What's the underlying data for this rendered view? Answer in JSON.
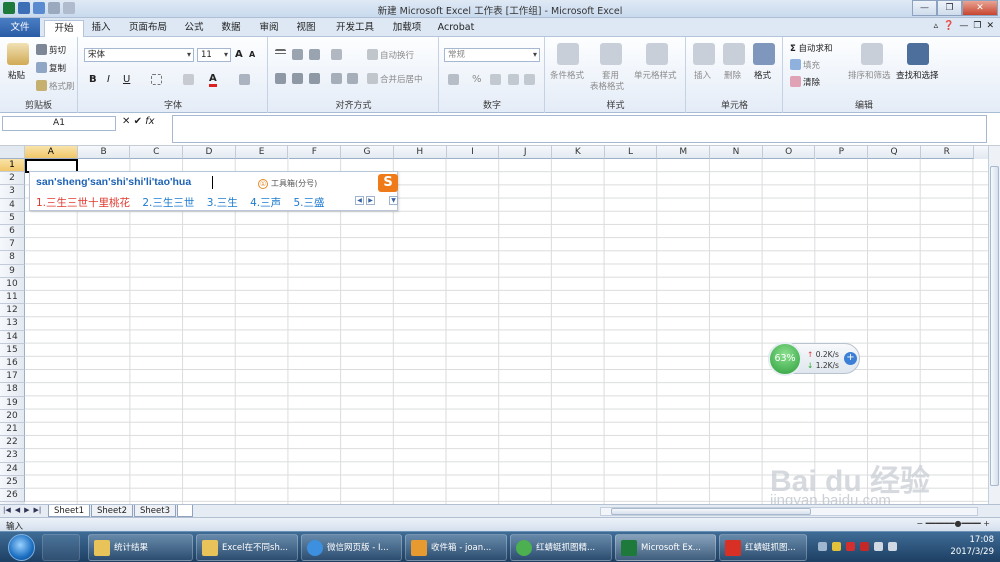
{
  "window": {
    "title": "新建 Microsoft Excel 工作表 [工作组] - Microsoft Excel"
  },
  "tabs": [
    "文件",
    "开始",
    "插入",
    "页面布局",
    "公式",
    "数据",
    "审阅",
    "视图",
    "开发工具",
    "加载项",
    "Acrobat"
  ],
  "active_tab": "开始",
  "ribbon": {
    "clipboard": {
      "label": "剪贴板",
      "paste": "粘贴",
      "cut": "剪切",
      "copy": "复制",
      "format_painter": "格式刷"
    },
    "font": {
      "label": "字体",
      "font_name": "宋体",
      "font_size": "11",
      "bold": "B",
      "italic": "I",
      "underline": "U",
      "grow": "A",
      "shrink": "A",
      "font_color": "A",
      "phonetic": "wén"
    },
    "alignment": {
      "label": "对齐方式",
      "wrap": "自动换行",
      "merge": "合并后居中"
    },
    "number": {
      "label": "数字",
      "format": "常规",
      "percent": "%"
    },
    "styles": {
      "label": "样式",
      "conditional": "条件格式",
      "table_format_1": "套用",
      "table_format_2": "表格格式",
      "cell_styles": "单元格样式"
    },
    "cells": {
      "label": "单元格",
      "insert": "插入",
      "delete": "删除",
      "format": "格式"
    },
    "editing": {
      "label": "编辑",
      "autosum": "自动求和",
      "fill": "填充",
      "clear": "清除",
      "sort": "排序和筛选",
      "find": "查找和选择"
    }
  },
  "formula_bar": {
    "name_box": "A1",
    "fx": "fx",
    "content": ""
  },
  "columns": [
    "A",
    "B",
    "C",
    "D",
    "E",
    "F",
    "G",
    "H",
    "I",
    "J",
    "K",
    "L",
    "M",
    "N",
    "O",
    "P",
    "Q",
    "R"
  ],
  "rows": [
    "1",
    "2",
    "3",
    "4",
    "5",
    "6",
    "7",
    "8",
    "9",
    "10",
    "11",
    "12",
    "13",
    "14",
    "15",
    "16",
    "17",
    "18",
    "19",
    "20",
    "21",
    "22",
    "23",
    "24",
    "25",
    "26"
  ],
  "selected_cell": "A1",
  "ime": {
    "pinyin": "san'sheng'san'shi'shi'li'tao'hua",
    "toolbox": "工具箱(分号)",
    "toolbox_num": "①",
    "logo": "S",
    "candidates": [
      "1.三生三世十里桃花",
      "2.三生三世",
      "3.三生",
      "4.三声",
      "5.三盛"
    ]
  },
  "net_widget": {
    "percent": "63%",
    "up": "0.2K/s",
    "down": "1.2K/s"
  },
  "sheets": [
    "Sheet1",
    "Sheet2",
    "Sheet3"
  ],
  "status": {
    "mode": "输入",
    "zoom": ""
  },
  "taskbar": {
    "items": [
      "统计结果",
      "Excel在不同sh...",
      "微信网页版 - I...",
      "收件箱 - joan...",
      "红蜻蜓抓图精...",
      "Microsoft Ex...",
      "红蜻蜓抓图..."
    ],
    "time": "17:08",
    "date": "2017/3/29"
  },
  "watermark": {
    "line1": "Bai du 经验",
    "line2": "jingyan.baidu.com"
  }
}
